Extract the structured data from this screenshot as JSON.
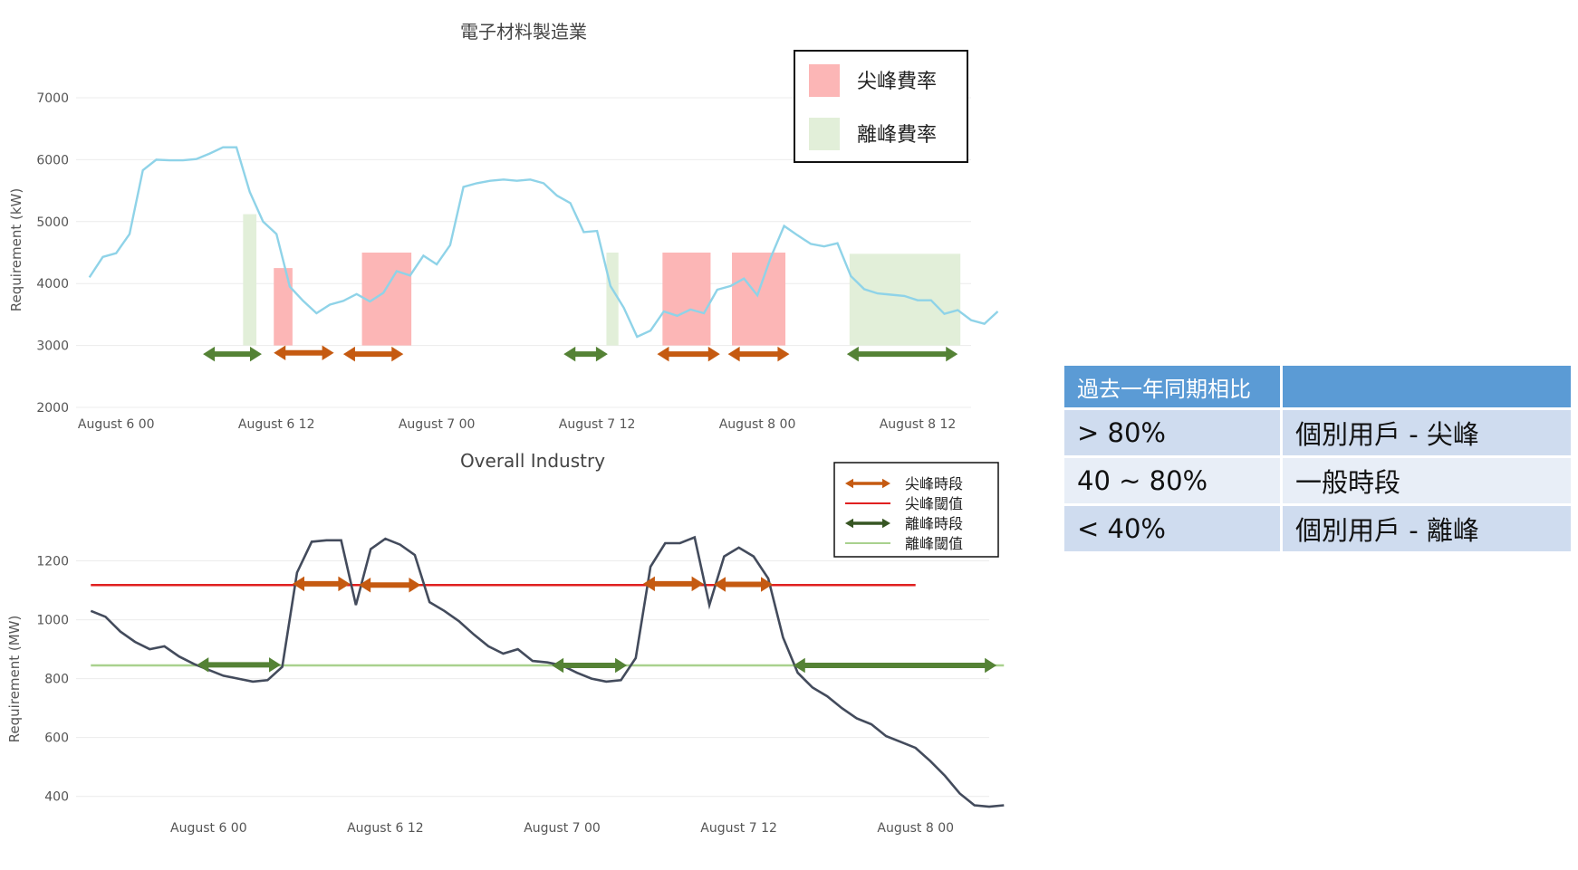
{
  "chart_data": [
    {
      "type": "line",
      "title": "電子材料製造業",
      "ylabel": "Requirement (kW)",
      "xlabel": "",
      "ylim": [
        2000,
        7000
      ],
      "yticks": [
        "2000",
        "3000",
        "4000",
        "5000",
        "6000",
        "7000"
      ],
      "xticks": [
        "August  6 00",
        "August  6 12",
        "August  7 00",
        "August  7 12",
        "August  8 00",
        "August  8 12"
      ],
      "xtick_positions": [
        2,
        14,
        26,
        38,
        50,
        62
      ],
      "x_range": [
        -1,
        66
      ],
      "series": [
        {
          "values": [
            4100,
            4430,
            4490,
            4800,
            5830,
            6000,
            5990,
            5990,
            6010,
            6100,
            6200,
            6200,
            5480,
            5000,
            4800,
            3950,
            3720,
            3520,
            3660,
            3720,
            3830,
            3710,
            3850,
            4200,
            4130,
            4450,
            4310,
            4620,
            5560,
            5620,
            5660,
            5680,
            5660,
            5680,
            5620,
            5420,
            5300,
            4830,
            4850,
            3960,
            3610,
            3140,
            3240,
            3550,
            3480,
            3580,
            3520,
            3900,
            3960,
            4080,
            3810,
            4420,
            4930,
            4780,
            4640,
            4600,
            4650,
            4120,
            3910,
            3840,
            3820,
            3800,
            3730,
            3730,
            3510,
            3570,
            3410,
            3350,
            3550
          ],
          "color": "#8fd3e8"
        }
      ],
      "shaded_regions": [
        {
          "x0": 11.5,
          "x1": 12.5,
          "y0": 3000,
          "y1": 5120,
          "color": "#e2efd9"
        },
        {
          "x0": 13.8,
          "x1": 15.2,
          "y0": 3000,
          "y1": 4250,
          "color": "#fcb6b6"
        },
        {
          "x0": 20.4,
          "x1": 24.1,
          "y0": 3000,
          "y1": 4500,
          "color": "#fcb6b6"
        },
        {
          "x0": 38.7,
          "x1": 39.6,
          "y0": 3000,
          "y1": 4500,
          "color": "#e2efd9"
        },
        {
          "x0": 42.9,
          "x1": 46.5,
          "y0": 3000,
          "y1": 4500,
          "color": "#fcb6b6"
        },
        {
          "x0": 48.1,
          "x1": 52.1,
          "y0": 3000,
          "y1": 4500,
          "color": "#fcb6b6"
        },
        {
          "x0": 56.9,
          "x1": 65.2,
          "y0": 3000,
          "y1": 4480,
          "color": "#e2efd9"
        }
      ],
      "arrows": [
        {
          "x0": 8.5,
          "x1": 12.9,
          "y": 2860,
          "color": "#548235"
        },
        {
          "x0": 13.8,
          "x1": 18.3,
          "y": 2880,
          "color": "#c55a11"
        },
        {
          "x0": 19.0,
          "x1": 23.5,
          "y": 2860,
          "color": "#c55a11"
        },
        {
          "x0": 35.5,
          "x1": 38.8,
          "y": 2860,
          "color": "#548235"
        },
        {
          "x0": 42.5,
          "x1": 47.2,
          "y": 2860,
          "color": "#c55a11"
        },
        {
          "x0": 47.8,
          "x1": 52.4,
          "y": 2860,
          "color": "#c55a11"
        },
        {
          "x0": 56.7,
          "x1": 65.0,
          "y": 2860,
          "color": "#548235"
        }
      ],
      "legend": [
        {
          "label": "尖峰費率",
          "color": "#fcb6b6"
        },
        {
          "label": "離峰費率",
          "color": "#e2efd9"
        }
      ],
      "legend_position": "top-right"
    },
    {
      "type": "line",
      "title": "Overall Industry",
      "ylabel": "Requirement (MW)",
      "xlabel": "",
      "ylim": [
        350,
        1300
      ],
      "yticks": [
        "400",
        "600",
        "800",
        "1000",
        "1200"
      ],
      "xticks": [
        "August  6 00",
        "August  6 12",
        "August  7 00",
        "August  7 12",
        "August  8 00"
      ],
      "xtick_positions": [
        8,
        20,
        32,
        44,
        56
      ],
      "x_range": [
        -1,
        61
      ],
      "series": [
        {
          "values": [
            1030,
            1010,
            960,
            925,
            900,
            910,
            875,
            850,
            830,
            810,
            800,
            790,
            795,
            840,
            1160,
            1265,
            1270,
            1270,
            1050,
            1240,
            1275,
            1255,
            1220,
            1060,
            1030,
            995,
            950,
            910,
            885,
            900,
            860,
            855,
            845,
            820,
            800,
            790,
            795,
            870,
            1180,
            1260,
            1260,
            1280,
            1050,
            1215,
            1245,
            1215,
            1140,
            940,
            820,
            770,
            740,
            700,
            665,
            645,
            605,
            585,
            565,
            520,
            470,
            410,
            370,
            365,
            370
          ],
          "color": "#434b5c"
        }
      ],
      "thresholds": [
        {
          "label": "尖峰閾值",
          "y": 1118,
          "x0": 0,
          "x1": 56,
          "color": "#e02020"
        },
        {
          "label": "離峰閾值",
          "y": 845,
          "x0": 0,
          "x1": 62,
          "color": "#a9d18e"
        }
      ],
      "arrows": [
        {
          "x0": 13.7,
          "x1": 17.6,
          "y": 1122,
          "color": "#c55a11"
        },
        {
          "x0": 18.2,
          "x1": 22.4,
          "y": 1118,
          "color": "#c55a11"
        },
        {
          "x0": 37.5,
          "x1": 41.6,
          "y": 1122,
          "color": "#c55a11"
        },
        {
          "x0": 42.3,
          "x1": 46.3,
          "y": 1120,
          "color": "#c55a11"
        },
        {
          "x0": 7.2,
          "x1": 12.9,
          "y": 847,
          "color": "#548235"
        },
        {
          "x0": 31.3,
          "x1": 36.4,
          "y": 845,
          "color": "#548235"
        },
        {
          "x0": 47.7,
          "x1": 61.5,
          "y": 845,
          "color": "#548235"
        }
      ],
      "legend": [
        {
          "label": "尖峰時段",
          "color": "#c55a11",
          "marker": "arrow"
        },
        {
          "label": "尖峰閾值",
          "color": "#e02020",
          "marker": "line"
        },
        {
          "label": "離峰時段",
          "color": "#375623",
          "marker": "arrow"
        },
        {
          "label": "離峰閾值",
          "color": "#a9d18e",
          "marker": "line"
        }
      ],
      "legend_position": "top-right"
    }
  ],
  "table": {
    "header": [
      "過去一年同期相比",
      ""
    ],
    "rows": [
      [
        "> 80%",
        "個別用戶 - 尖峰"
      ],
      [
        "40 ~ 80%",
        "一般時段"
      ],
      [
        "< 40%",
        "個別用戶 -  離峰"
      ]
    ]
  }
}
